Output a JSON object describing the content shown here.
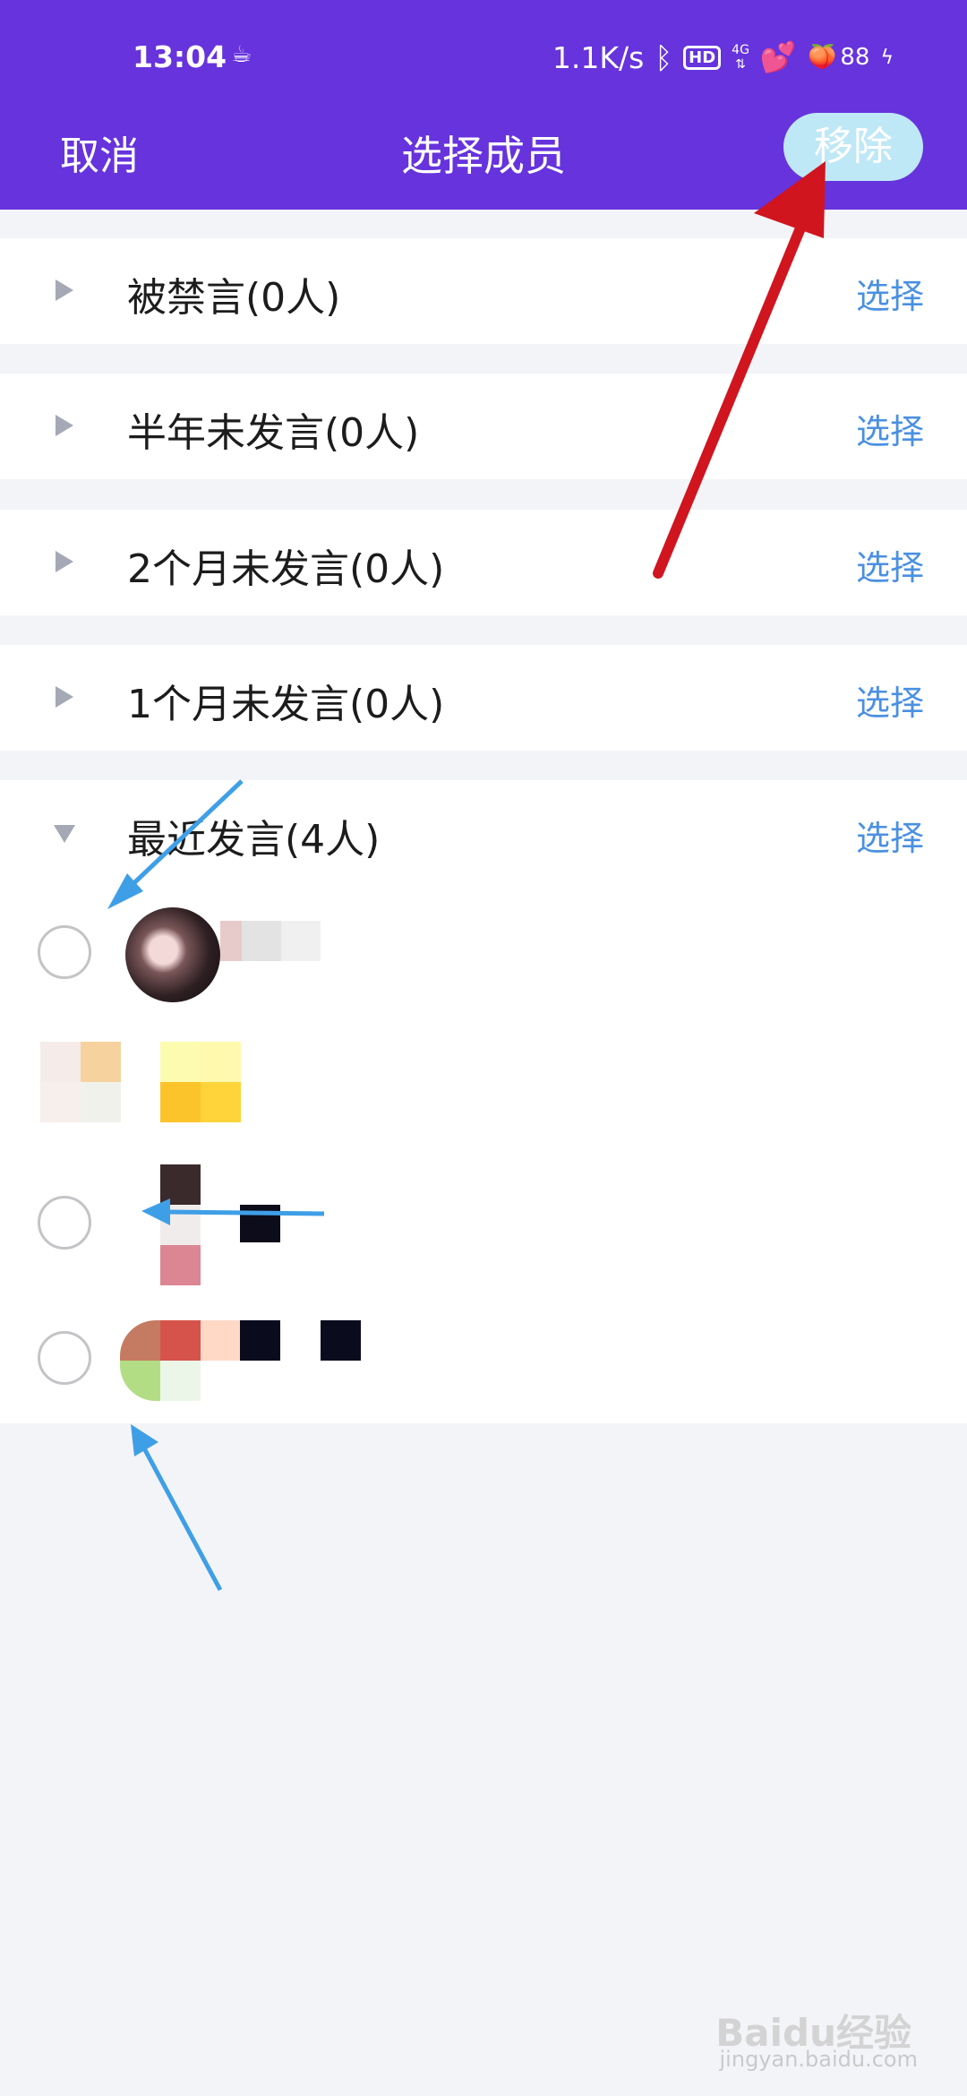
{
  "status_bar": {
    "time": "13:04",
    "net_speed": "1.1K/s",
    "hd": "HD",
    "network": "4G",
    "battery": "88"
  },
  "header": {
    "cancel_label": "取消",
    "title": "选择成员",
    "remove_label": "移除"
  },
  "groups": [
    {
      "label": "被禁言(0人)",
      "action": "选择",
      "expanded": false
    },
    {
      "label": "半年未发言(0人)",
      "action": "选择",
      "expanded": false
    },
    {
      "label": "2个月未发言(0人)",
      "action": "选择",
      "expanded": false
    },
    {
      "label": "1个月未发言(0人)",
      "action": "选择",
      "expanded": false
    },
    {
      "label": "最近发言(4人)",
      "action": "选择",
      "expanded": true
    }
  ],
  "watermark": {
    "logo": "Baidu经验",
    "url": "jingyan.baidu.com"
  },
  "colors": {
    "header": "#6633dd",
    "remove_button": "#bfe8f6",
    "link": "#4a90e2",
    "annotation_red": "#d0151f",
    "annotation_blue": "#3f9fe6"
  }
}
